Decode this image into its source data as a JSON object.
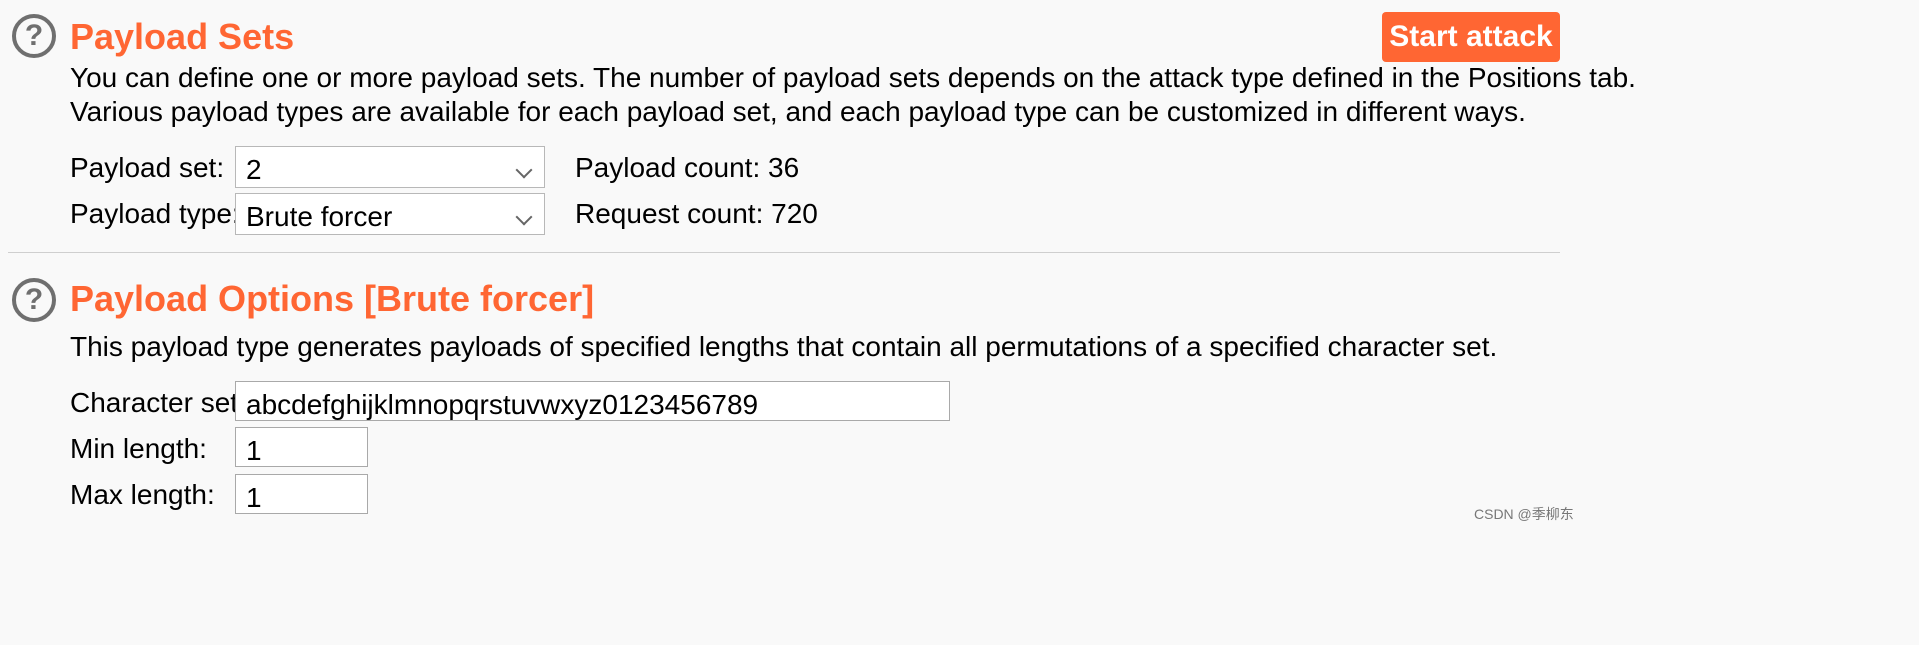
{
  "payload_sets": {
    "title": "Payload Sets",
    "help_icon": "question-circle-icon",
    "description_line1": "You can define one or more payload sets. The number of payload sets depends on the attack type defined in the Positions tab.",
    "description_line2": "Various payload types are available for each payload set, and each payload type can be customized in different ways.",
    "payload_set_label": "Payload set:",
    "payload_set_value": "2",
    "payload_type_label": "Payload type:",
    "payload_type_value": "Brute forcer",
    "payload_count": "Payload count: 36",
    "request_count": "Request count: 720"
  },
  "toolbar": {
    "start_attack_label": "Start attack"
  },
  "payload_options": {
    "title": "Payload Options [Brute forcer]",
    "help_icon": "question-circle-icon",
    "description": "This payload type generates payloads of specified lengths that contain all permutations of a specified character set.",
    "character_set_label": "Character set:",
    "character_set_value": "abcdefghijklmnopqrstuvwxyz0123456789",
    "min_length_label": "Min length:",
    "min_length_value": "1",
    "max_length_label": "Max length:",
    "max_length_value": "1"
  },
  "watermark": "CSDN @季柳东",
  "colors": {
    "accent": "#ff6633",
    "icon_gray": "#6f6f6f",
    "background": "#f9f9f9"
  }
}
